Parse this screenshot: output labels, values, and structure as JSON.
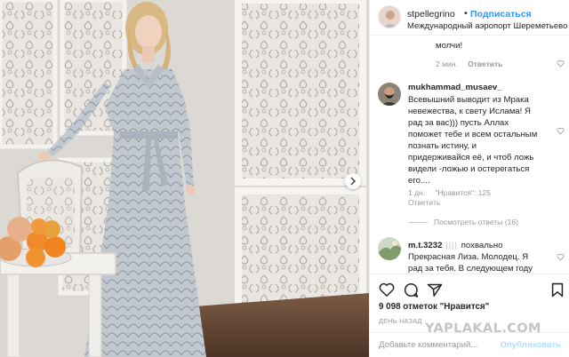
{
  "post": {
    "username": "stpellegrino",
    "separator": "•",
    "follow_label": "Подписаться",
    "location": "Международный аэропорт Шереметьево"
  },
  "comments": [
    {
      "text": "молчи!",
      "time": "2 мин.",
      "reply_label": "Ответить"
    },
    {
      "username": "mukhammad_musaev_",
      "lines": [
        "Всевышний выводит из Мрака",
        "невежества, к свету Ислама! Я",
        "рад за вас))) пусть Аллах",
        "поможет тебе и всем остальным",
        "познать истину, и",
        "придерживайся её, и чтоб ложь",
        "видели -ложью и остерегаться",
        "его...."
      ],
      "time": "1 дн.",
      "likes_label": "\"Нравится\": 125",
      "reply_label": "Ответить",
      "view_replies": "Посмотреть ответы (16)"
    },
    {
      "username": "m.t.3232",
      "first_line_text": "похвально",
      "lines": [
        "Прекрасная Лиза. Молодец. Я",
        "рад за тебя. В следующем году"
      ]
    }
  ],
  "stats": {
    "likes": "9 098 отметок \"Нравится\"",
    "posted": "ДЕНЬ НАЗАД"
  },
  "add_comment": {
    "placeholder": "Добавьте комментарий...",
    "publish_label": "Опубликовать"
  },
  "watermark": "YAPLAKAL.COM",
  "icons": [
    "heart-icon",
    "comment-icon",
    "share-icon",
    "bookmark-icon",
    "chevron-right-icon"
  ],
  "colors": {
    "link_blue": "#3897f0",
    "muted_text": "#999999",
    "border": "#efefef"
  }
}
